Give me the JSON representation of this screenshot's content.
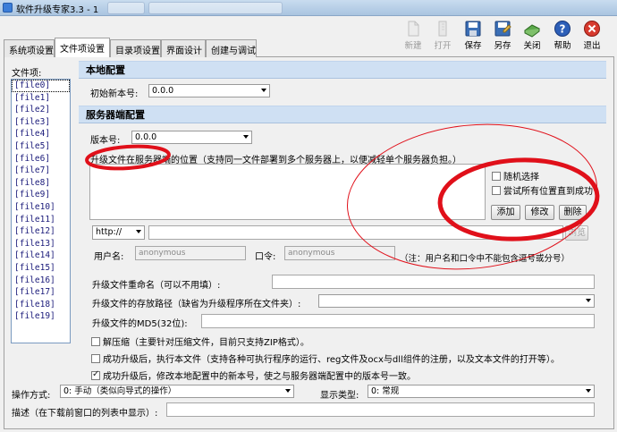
{
  "window": {
    "title": "软件升级专家3.3 - 1"
  },
  "toolbar": {
    "items": [
      {
        "label": "新建",
        "icon": "new-document-icon",
        "enabled": false
      },
      {
        "label": "打开",
        "icon": "open-folder-icon",
        "enabled": false
      },
      {
        "label": "保存",
        "icon": "save-disk-icon",
        "enabled": true
      },
      {
        "label": "另存",
        "icon": "save-as-disk-icon",
        "enabled": true
      },
      {
        "label": "关闭",
        "icon": "close-book-icon",
        "enabled": true
      },
      {
        "label": "帮助",
        "icon": "help-icon",
        "enabled": true
      },
      {
        "label": "退出",
        "icon": "exit-icon",
        "enabled": true
      }
    ]
  },
  "tabs": [
    "系统项设置",
    "文件项设置",
    "目录项设置",
    "界面设计",
    "创建与调试"
  ],
  "active_tab": 1,
  "sidebar": {
    "label": "文件项:",
    "files": [
      "[file0]",
      "[file1]",
      "[file2]",
      "[file3]",
      "[file4]",
      "[file5]",
      "[file6]",
      "[file7]",
      "[file8]",
      "[file9]",
      "[file10]",
      "[file11]",
      "[file12]",
      "[file13]",
      "[file14]",
      "[file15]",
      "[file16]",
      "[file17]",
      "[file18]",
      "[file19]"
    ],
    "selected": 0
  },
  "local": {
    "header": "本地配置",
    "initial_version_label": "初始新本号:",
    "initial_version_value": "0.0.0"
  },
  "server": {
    "header": "服务器端配置",
    "version_label": "版本号:",
    "version_value": "0.0.0",
    "locations_label": "升级文件在服务器端的位置（支持同一文件部署到多个服务器上，以便减轻单个服务器负担。）",
    "random_select": "随机选择",
    "try_all": "尝试所有位置直到成功",
    "add_button": "添加",
    "modify_button": "修改",
    "delete_button": "删除",
    "protocol_value": "http://",
    "browse_button": "浏览",
    "username_label": "用户名:",
    "username_placeholder": "anonymous",
    "password_label": "口令:",
    "password_placeholder": "anonymous",
    "note": "（注：用户名和口令中不能包含逗号或分号）"
  },
  "options": {
    "rename_label": "升级文件重命名（可以不用填）:",
    "storage_path_label": "升级文件的存放路径（缺省为升级程序所在文件夹）:",
    "md5_label": "升级文件的MD5(32位):",
    "decompress": {
      "label": "解压缩（主要针对压缩文件，目前只支持ZIP格式）。",
      "checked": false
    },
    "execute_after": {
      "label": "成功升级后，执行本文件（支持各种可执行程序的运行、reg文件及ocx与dll组件的注册，以及文本文件的打开等）。",
      "checked": false
    },
    "sync_version": {
      "label": "成功升级后，修改本地配置中的新本号，使之与服务器端配置中的版本号一致。",
      "checked": true
    }
  },
  "footer": {
    "operation_label": "操作方式:",
    "operation_value": "0: 手动（类似向导式的操作）",
    "display_label": "显示类型:",
    "display_value": "0: 常规",
    "description_label": "描述（在下载前窗口的列表中显示）:"
  },
  "colors": {
    "section_header": "#cfe0f3",
    "annotation": "#e0101a",
    "titlebar": "#b5cde8"
  }
}
